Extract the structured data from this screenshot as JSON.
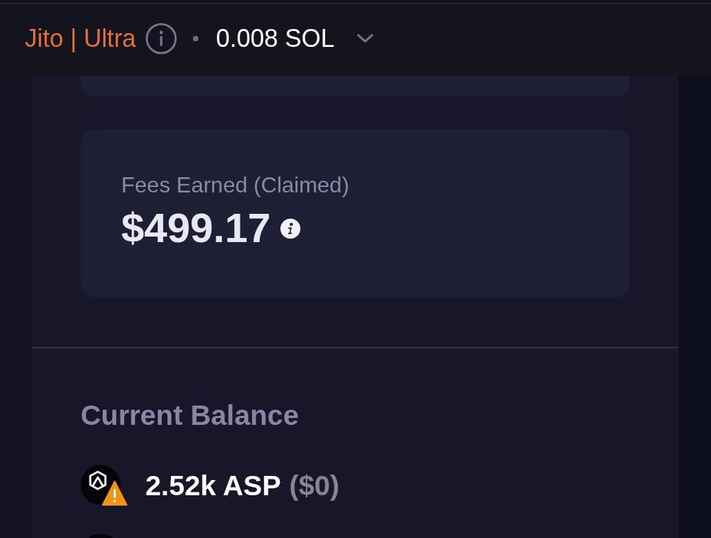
{
  "header": {
    "mode": "Jito | Ultra",
    "balance": "0.008 SOL"
  },
  "fees_card": {
    "label": "Fees Earned (Claimed)",
    "value": "$499.17"
  },
  "current_balance": {
    "title": "Current Balance",
    "tokens": [
      {
        "kind": "full",
        "amount": "2.52k ASP",
        "usd_value": "($0)",
        "warning": true
      },
      {
        "kind": "cut_off"
      }
    ]
  }
}
